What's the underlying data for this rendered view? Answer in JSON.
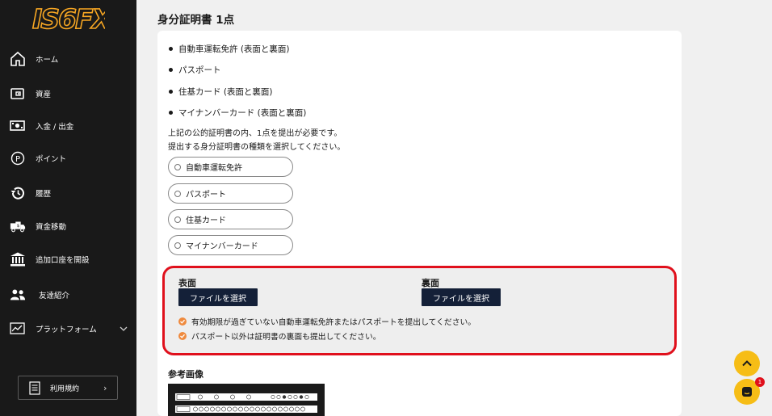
{
  "logo": {
    "text": "IS6FX"
  },
  "sidebar": {
    "items": [
      {
        "label": "ホーム",
        "icon": "home-icon"
      },
      {
        "label": "資産",
        "icon": "wallet-icon"
      },
      {
        "label": "入金 / 出金",
        "icon": "money-icon"
      },
      {
        "label": "ポイント",
        "icon": "points-icon"
      },
      {
        "label": "履歴",
        "icon": "history-icon"
      },
      {
        "label": "資金移動",
        "icon": "truck-icon"
      },
      {
        "label": "追加口座を開設",
        "icon": "bank-icon"
      },
      {
        "label": "友達紹介",
        "icon": "users-icon"
      },
      {
        "label": "プラットフォーム",
        "icon": "chart-icon"
      }
    ],
    "terms": {
      "label": "利用規約",
      "arrow": "›"
    }
  },
  "main": {
    "title": "身分証明書 1点",
    "bullets": [
      "自動車運転免許 (表面と裏面)",
      "パスポート",
      "住基カード (表面と裏面)",
      "マイナンバーカード (表面と裏面)"
    ],
    "instruction_1": "上記の公的証明書の内、1点を提出が必要です。",
    "instruction_2": "提出する身分証明書の種類を選択してください。",
    "options": [
      "自動車運転免許",
      "パスポート",
      "住基カード",
      "マイナンバーカード"
    ],
    "upload": {
      "front_label": "表面",
      "back_label": "裏面",
      "file_button": "ファイルを選択",
      "notes": [
        "有効期限が過ぎていない自動車運転免許またはパスポートを提出してください。",
        "パスポート以外は証明書の裏面も提出してください。"
      ]
    },
    "reference_title": "参考画像"
  },
  "chat": {
    "badge": "1"
  },
  "colors": {
    "sidebar_bg": "#191919",
    "logo": "#f6a623",
    "highlight_border": "#e0101c",
    "button_bg": "#142038",
    "check": "#ef8a3e",
    "fab": "#f6bd16"
  }
}
